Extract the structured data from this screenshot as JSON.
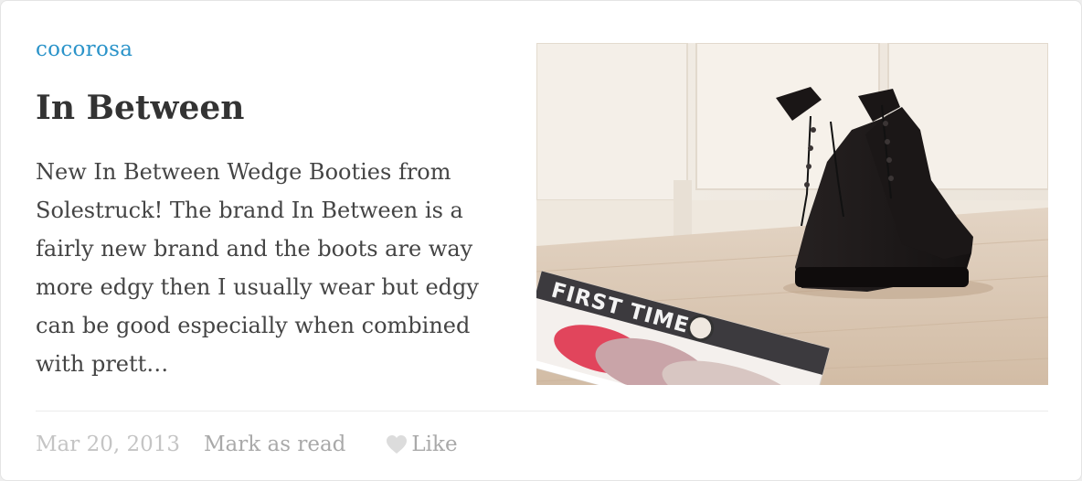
{
  "card": {
    "source": "cocorosa",
    "title": "In Between",
    "excerpt": "New In Between Wedge Booties from Solestruck! The brand In Between is a fairly new brand and the boots are way more edgy then I usually wear but edgy can be good especially when combined with prett…",
    "image": {
      "magazine_text": "FIRST TIME"
    }
  },
  "footer": {
    "date": "Mar 20, 2013",
    "mark_read_label": "Mark as read",
    "like_label": "Like",
    "like_icon": "heart-icon"
  },
  "colors": {
    "source_link": "#2a93c9",
    "title": "#333333",
    "body_text": "#444444",
    "muted": "#b5b5b5"
  }
}
